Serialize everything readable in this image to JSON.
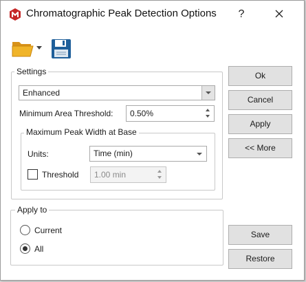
{
  "window": {
    "title": "Chromatographic Peak Detection Options",
    "help_glyph": "?",
    "icon": "app-logo-icon",
    "accent_color": "#c62828"
  },
  "toolbar": {
    "open_icon": "folder-open-icon",
    "save_icon": "save-disk-icon",
    "folder_color": "#e8a317",
    "disk_color": "#1f5f9a"
  },
  "settings": {
    "title": "Settings",
    "mode_value": "Enhanced",
    "min_area_label": "Minimum Area Threshold:",
    "min_area_value": "0.50%",
    "max_peak_group_title": "Maximum Peak Width at Base",
    "units_label": "Units:",
    "units_value": "Time (min)",
    "threshold_label": "Threshold",
    "threshold_checked": false,
    "threshold_value": "1.00 min"
  },
  "apply_to": {
    "title": "Apply to",
    "options": [
      {
        "label": "Current",
        "selected": false
      },
      {
        "label": "All",
        "selected": true
      }
    ]
  },
  "buttons": {
    "ok": "Ok",
    "cancel": "Cancel",
    "apply": "Apply",
    "more": "<< More",
    "save": "Save",
    "restore": "Restore"
  }
}
